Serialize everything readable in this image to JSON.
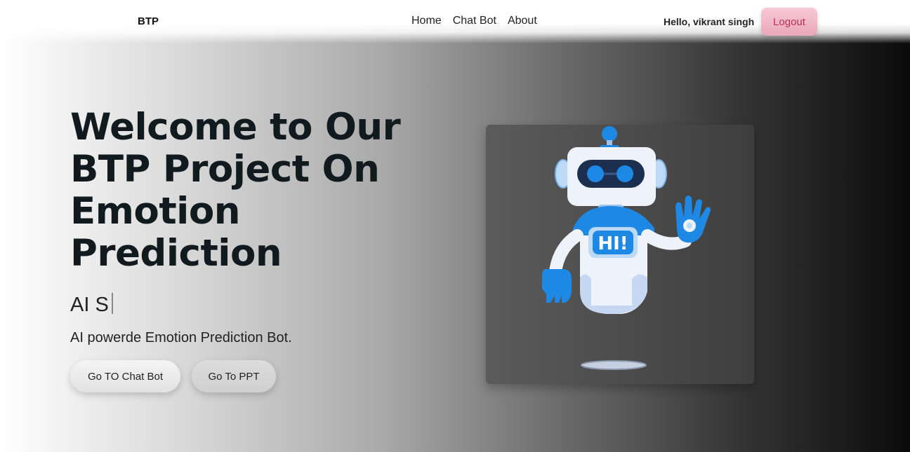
{
  "navbar": {
    "brand": "BTP",
    "links": [
      "Home",
      "Chat Bot",
      "About"
    ],
    "greeting": "Hello, vikrant singh",
    "logout_label": "Logout"
  },
  "hero": {
    "title": "Welcome to Our BTP Project On Emotion Prediction",
    "typing_text": "AI S",
    "subtitle": "AI powerde Emotion Prediction Bot.",
    "buttons": {
      "chat_bot": "Go TO Chat Bot",
      "ppt": "Go To PPT"
    }
  },
  "robot": {
    "icon": "robot-waving-illustration",
    "badge_text": "HI!",
    "colors": {
      "accent_blue": "#1e88e5",
      "body_white": "#eef3fb"
    }
  }
}
